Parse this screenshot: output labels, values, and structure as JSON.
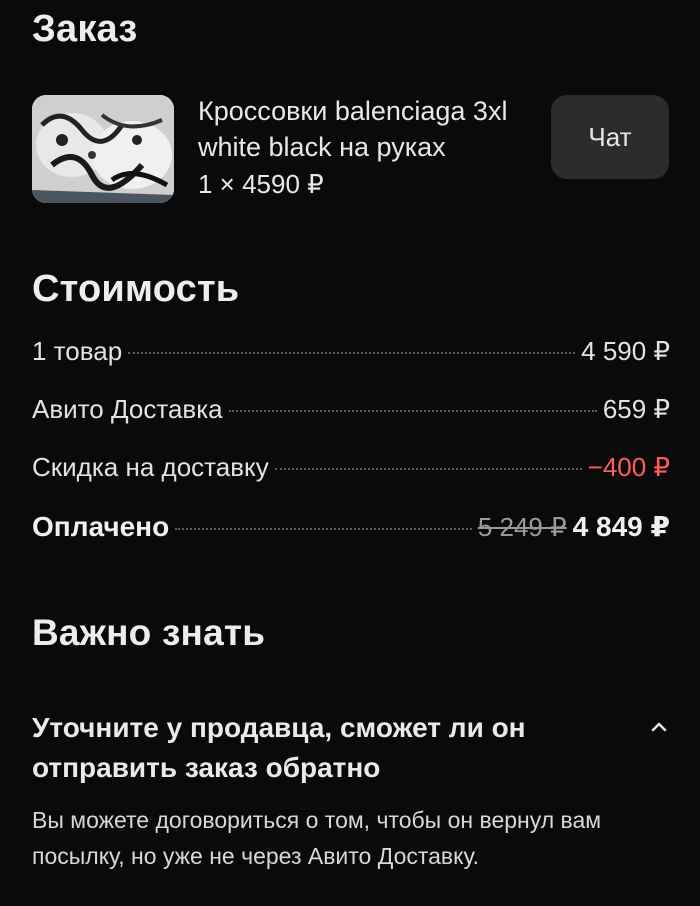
{
  "order": {
    "title": "Заказ",
    "product_name": "Кроссовки balenciaga 3xl white black на руках",
    "quantity_price": "1 × 4590 ₽",
    "chat_label": "Чат"
  },
  "cost": {
    "title": "Стоимость",
    "rows": [
      {
        "label": "1 товар",
        "value": "4 590 ₽"
      },
      {
        "label": "Авито Доставка",
        "value": "659 ₽"
      },
      {
        "label": "Скидка на доставку",
        "value": "−400 ₽"
      }
    ],
    "total": {
      "label": "Оплачено",
      "old_value": "5 249 ₽",
      "value": "4 849 ₽"
    },
    "discount_color": "#ff5c5c"
  },
  "important": {
    "title": "Важно знать",
    "notice_title": "Уточните у продавца, сможет ли он отправить заказ обратно",
    "notice_body": "Вы можете договориться о том, чтобы он вернул вам посылку, но уже не через Авито Доставку.",
    "toggle_icon": "chevron-up-icon"
  }
}
